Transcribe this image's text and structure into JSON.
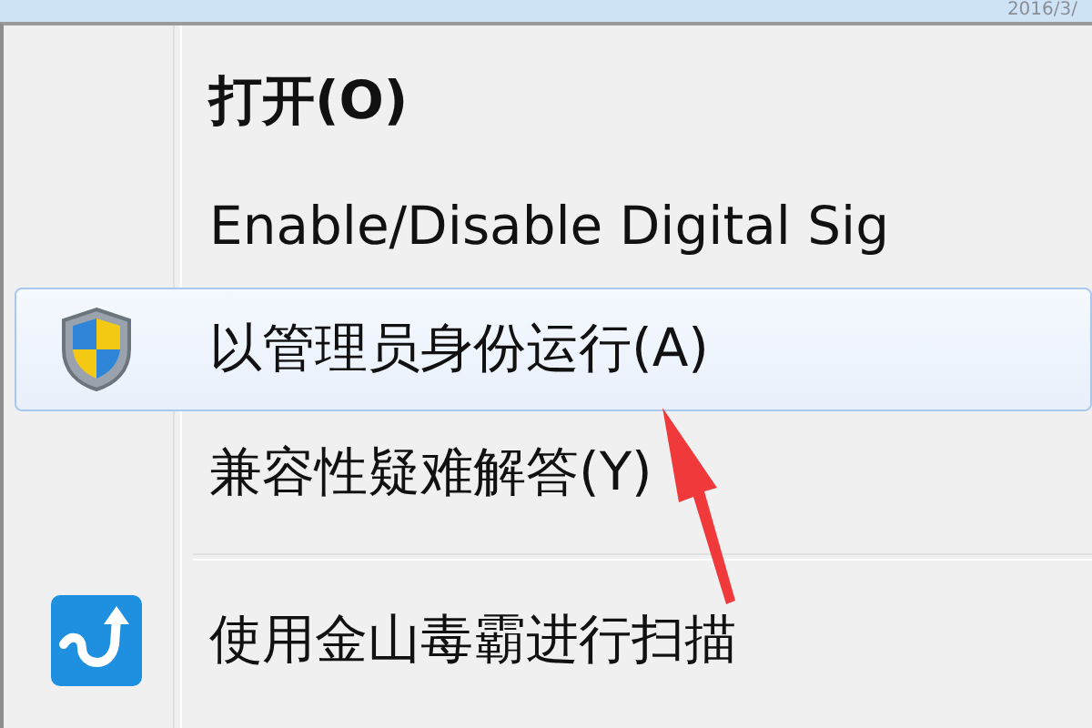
{
  "header": {
    "date": "2016/3/"
  },
  "menu": {
    "items": [
      {
        "kind": "plain",
        "label": "打开(O)",
        "default": true,
        "selected": false
      },
      {
        "kind": "plain",
        "label": "Enable/Disable Digital Sig",
        "default": false,
        "selected": false
      },
      {
        "kind": "shield",
        "label": "以管理员身份运行(A)",
        "default": false,
        "selected": true
      },
      {
        "kind": "plain",
        "label": "兼容性疑难解答(Y)",
        "default": false,
        "selected": false
      },
      {
        "kind": "separator"
      },
      {
        "kind": "scan",
        "label": "使用金山毒霸进行扫描",
        "default": false,
        "selected": false
      }
    ]
  }
}
